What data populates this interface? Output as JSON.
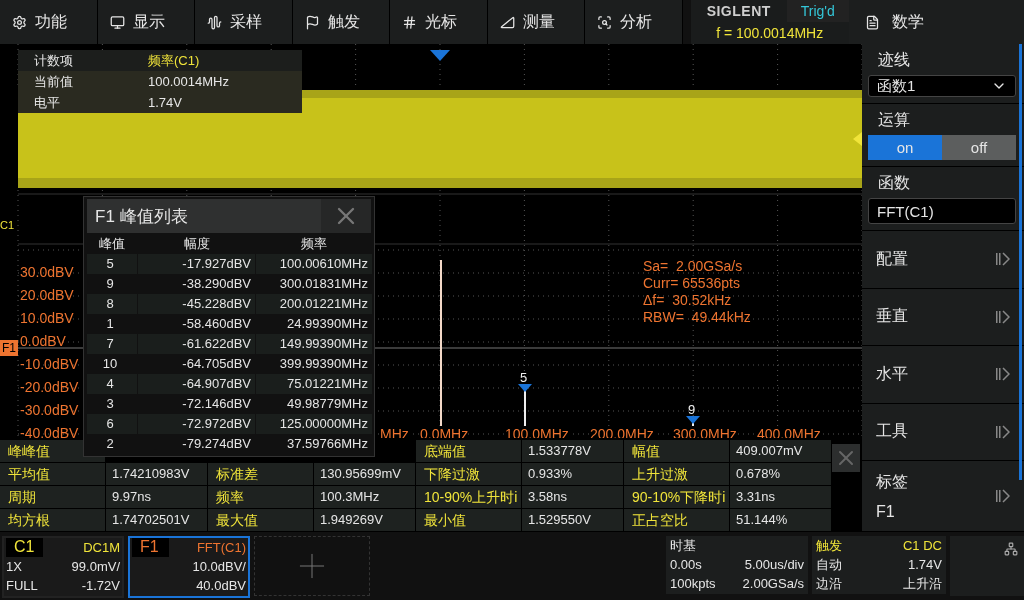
{
  "menu": [
    {
      "label": "功能"
    },
    {
      "label": "显示"
    },
    {
      "label": "采样"
    },
    {
      "label": "触发"
    },
    {
      "label": "光标"
    },
    {
      "label": "测量"
    },
    {
      "label": "分析"
    }
  ],
  "brand": "SIGLENT",
  "trigger_state": "Trig'd",
  "frequency": "f = 100.0014MHz",
  "side_title": "数学",
  "counter": [
    {
      "label": "计数项",
      "value": "频率(C1)",
      "highlight": true
    },
    {
      "label": "当前值",
      "value": "100.0014MHz",
      "highlight": false
    },
    {
      "label": "电平",
      "value": "1.74V",
      "highlight": false
    }
  ],
  "channel_marker": "C1",
  "fft_marker": "F1",
  "fft_y_labels": [
    "30.0dBV",
    "20.0dBV",
    "10.0dBV",
    "0.0dBV",
    "-10.0dBV",
    "-20.0dBV",
    "-30.0dBV",
    "-40.0dBV"
  ],
  "fft_x_labels": [
    "MHz",
    "0.0MHz",
    "100.0MHz",
    "200.0MHz",
    "300.0MHz",
    "400.0MHz"
  ],
  "fft_info": [
    "Sa=  2.00GSa/s",
    "Curr= 65536pts",
    "Δf=  30.52kHz",
    "RBW=  49.44kHz"
  ],
  "peak_markers": [
    {
      "label": "5"
    },
    {
      "label": "9"
    }
  ],
  "peak_table": {
    "title": "F1 峰值列表",
    "columns": [
      "峰值",
      "幅度",
      "频率"
    ],
    "rows": [
      [
        "5",
        "-17.927dBV",
        "100.00610MHz"
      ],
      [
        "9",
        "-38.290dBV",
        "300.01831MHz"
      ],
      [
        "8",
        "-45.228dBV",
        "200.01221MHz"
      ],
      [
        "1",
        "-58.460dBV",
        "24.99390MHz"
      ],
      [
        "7",
        "-61.622dBV",
        "149.99390MHz"
      ],
      [
        "10",
        "-64.705dBV",
        "399.99390MHz"
      ],
      [
        "4",
        "-64.907dBV",
        "75.01221MHz"
      ],
      [
        "3",
        "-72.146dBV",
        "49.98779MHz"
      ],
      [
        "6",
        "-72.972dBV",
        "125.00000MHz"
      ],
      [
        "2",
        "-79.274dBV",
        "37.59766MHz"
      ]
    ]
  },
  "measurements_first_row": {
    "label": "峰峰值",
    "right_items": [
      {
        "label": "底端值",
        "value": "1.533778V"
      },
      {
        "label": "幅值",
        "value": "409.007mV"
      }
    ]
  },
  "measurements": [
    [
      {
        "label": "平均值",
        "value": "1.74210983V"
      },
      {
        "label": "标准差",
        "value": "130.95699mV"
      },
      {
        "label": "下降过激",
        "value": "0.933%"
      },
      {
        "label": "上升过激",
        "value": "0.678%"
      }
    ],
    [
      {
        "label": "周期",
        "value": "9.97ns"
      },
      {
        "label": "频率",
        "value": "100.3MHz"
      },
      {
        "label": "10-90%上升时i",
        "value": "3.58ns"
      },
      {
        "label": "90-10%下降时i",
        "value": "3.31ns"
      }
    ],
    [
      {
        "label": "均方根",
        "value": "1.74702501V"
      },
      {
        "label": "最大值",
        "value": "1.949269V"
      },
      {
        "label": "最小值",
        "value": "1.529550V"
      },
      {
        "label": "正占空比",
        "value": "51.144%"
      }
    ]
  ],
  "side": {
    "trace": {
      "label": "迹线",
      "value": "函数1"
    },
    "operation": {
      "label": "运算",
      "options": [
        {
          "label": "on",
          "selected": true
        },
        {
          "label": "off",
          "selected": false
        }
      ]
    },
    "function": {
      "label": "函数",
      "value": "FFT(C1)"
    },
    "items": [
      {
        "label": "配置"
      },
      {
        "label": "垂直"
      },
      {
        "label": "水平"
      },
      {
        "label": "工具"
      },
      {
        "label": "标签",
        "value": "F1"
      }
    ]
  },
  "channels": [
    {
      "name": "C1",
      "kind": "analog",
      "selected": false,
      "top_right": "DC1M",
      "row1_left": "1X",
      "row1_right": "99.0mV/",
      "row2_left": "FULL",
      "row2_right": "-1.72V"
    },
    {
      "name": "F1",
      "kind": "math",
      "selected": true,
      "top_right": "FFT(C1)",
      "row1_right": "10.0dBV/",
      "row2_right": "40.0dBV"
    }
  ],
  "timebase": {
    "title": "时基",
    "delay": "0.00s",
    "scale": "5.00us/div",
    "memory": "100kpts",
    "rate": "2.00GSa/s"
  },
  "trigger": {
    "title": "触发",
    "source": "C1 DC",
    "mode": "自动",
    "level": "1.74V",
    "type": "边沿",
    "slope": "上升沿"
  }
}
